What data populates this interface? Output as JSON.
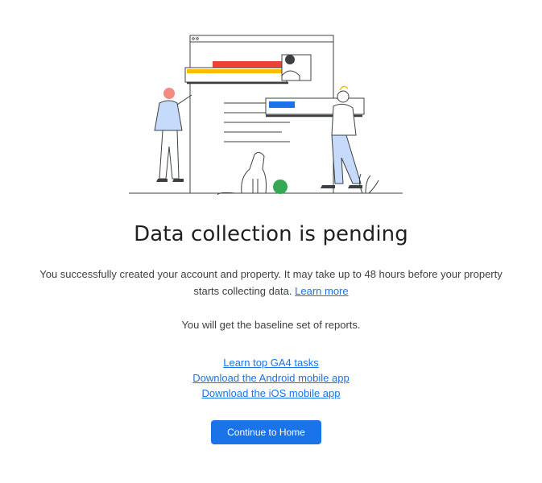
{
  "illustration": {
    "name": "data-collection-pending-illustration",
    "colors": {
      "line": "#3c4043",
      "red": "#ea4335",
      "yellow": "#fbbc04",
      "blue": "#1a73e8",
      "green": "#34a853",
      "shirt_light_blue": "#c6dafc",
      "hair_orange": "#f28b82"
    }
  },
  "main": {
    "title": "Data collection is pending",
    "description": "You successfully created your account and property. It may take up to 48 hours before your property starts collecting data.",
    "learn_more_label": "Learn more",
    "baseline_text": "You will get the baseline set of reports.",
    "links": [
      "Learn top GA4 tasks",
      "Download the Android mobile app",
      "Download the iOS mobile app"
    ],
    "continue_button_label": "Continue to Home"
  },
  "theme": {
    "accent": "#1a73e8",
    "title_color": "#202124",
    "text_color": "#3c4043"
  }
}
